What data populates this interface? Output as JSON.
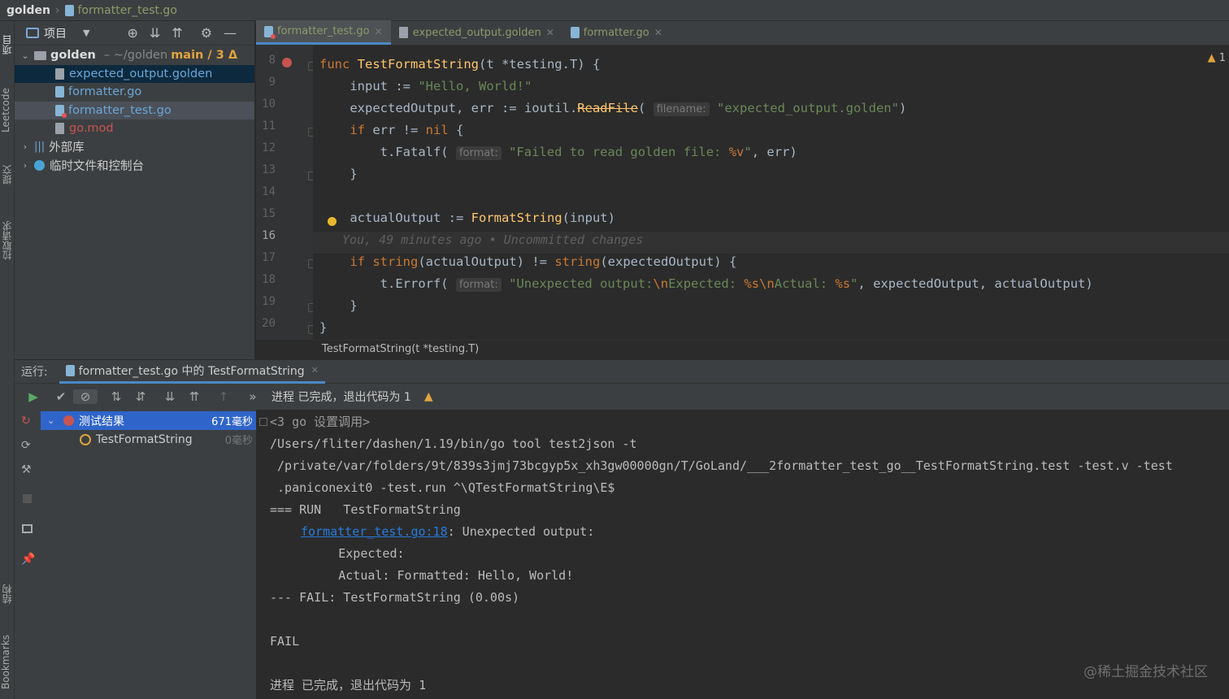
{
  "topbar": {
    "project": "golden",
    "file": "formatter_test.go"
  },
  "leftstrip": {
    "labels": [
      "项目",
      "Leetcode",
      "提交",
      "拉取请求",
      "结构",
      "Bookmarks"
    ]
  },
  "project_panel": {
    "title": "项目",
    "root": {
      "name": "golden",
      "path": "~/golden",
      "branch": "main / 3 Δ"
    },
    "items": [
      {
        "name": "expected_output.golden",
        "color": "#6a9fd1"
      },
      {
        "name": "formatter.go",
        "color": "#6a9fd1"
      },
      {
        "name": "formatter_test.go",
        "color": "#6a9fd1"
      },
      {
        "name": "go.mod",
        "color": "#c75450"
      }
    ],
    "external": "外部库",
    "scratch": "临时文件和控制台"
  },
  "editor_tabs": [
    {
      "label": "formatter_test.go",
      "active": true
    },
    {
      "label": "expected_output.golden",
      "active": false
    },
    {
      "label": "formatter.go",
      "active": false
    }
  ],
  "editor": {
    "warning_count": "1",
    "line_numbers": [
      "8",
      "9",
      "10",
      "11",
      "12",
      "13",
      "14",
      "15",
      "16",
      "17",
      "18",
      "19",
      "20"
    ],
    "inline_blame": "You, 49 minutes ago • Uncommitted changes",
    "breadcrumb": "TestFormatString(t *testing.T)",
    "code": {
      "l8_kw": "func",
      "l8_fn": "TestFormatString",
      "l8_rest": "(t *testing.T) {",
      "l9_a": "    input := ",
      "l9_str": "\"Hello, World!\"",
      "l10_a": "    expectedOutput, err := ioutil.",
      "l10_fn": "ReadFile",
      "l10_b": "( ",
      "l10_hint": "filename:",
      "l10_str": " \"expected_output.golden\"",
      "l10_c": ")",
      "l11_a": "    ",
      "l11_kw": "if",
      "l11_b": " err != ",
      "l11_nil": "nil",
      "l11_c": " {",
      "l12_a": "        t.Fatalf( ",
      "l12_hint": "format:",
      "l12_str": " \"Failed to read golden file: ",
      "l12_fmt": "%v",
      "l12_str2": "\"",
      "l12_c": ", err)",
      "l13": "    }",
      "l15_a": "    actualOutput := ",
      "l15_fn": "FormatString",
      "l15_b": "(input)",
      "l17_a": "    ",
      "l17_kw": "if",
      "l17_b": " ",
      "l17_fn1": "string",
      "l17_c": "(actualOutput) != ",
      "l17_fn2": "string",
      "l17_d": "(expectedOutput) {",
      "l18_a": "        t.Errorf( ",
      "l18_hint": "format:",
      "l18_s1": " \"Unexpected output:",
      "l18_e1": "\\n",
      "l18_s2": "Expected: ",
      "l18_f1": "%s",
      "l18_e2": "\\n",
      "l18_s3": "Actual: ",
      "l18_f2": "%s",
      "l18_s4": "\"",
      "l18_c": ", expectedOutput, actualOutput)",
      "l19": "    }",
      "l20": "}"
    }
  },
  "run": {
    "label": "运行:",
    "tab": "formatter_test.go 中的 TestFormatString",
    "status": "进程 已完成，退出代码为 1",
    "tree": [
      {
        "name": "测试结果",
        "time": "671毫秒"
      },
      {
        "name": "TestFormatString",
        "time": "0毫秒"
      }
    ],
    "console": [
      "<3 go 设置调用>",
      "/Users/fliter/dashen/1.19/bin/go tool test2json -t",
      " /private/var/folders/9t/839s3jmj73bcgyp5x_xh3gw00000gn/T/GoLand/___2formatter_test_go__TestFormatString.test -test.v -test",
      " .paniconexit0 -test.run ^\\QTestFormatString\\E$",
      "=== RUN   TestFormatString",
      "formatter_test.go:18",
      ": Unexpected output:",
      "        Expected:",
      "        Actual: Formatted: Hello, World!",
      "--- FAIL: TestFormatString (0.00s)",
      "FAIL",
      "进程 已完成，退出代码为 1"
    ]
  },
  "watermark": "@稀土掘金技术社区"
}
